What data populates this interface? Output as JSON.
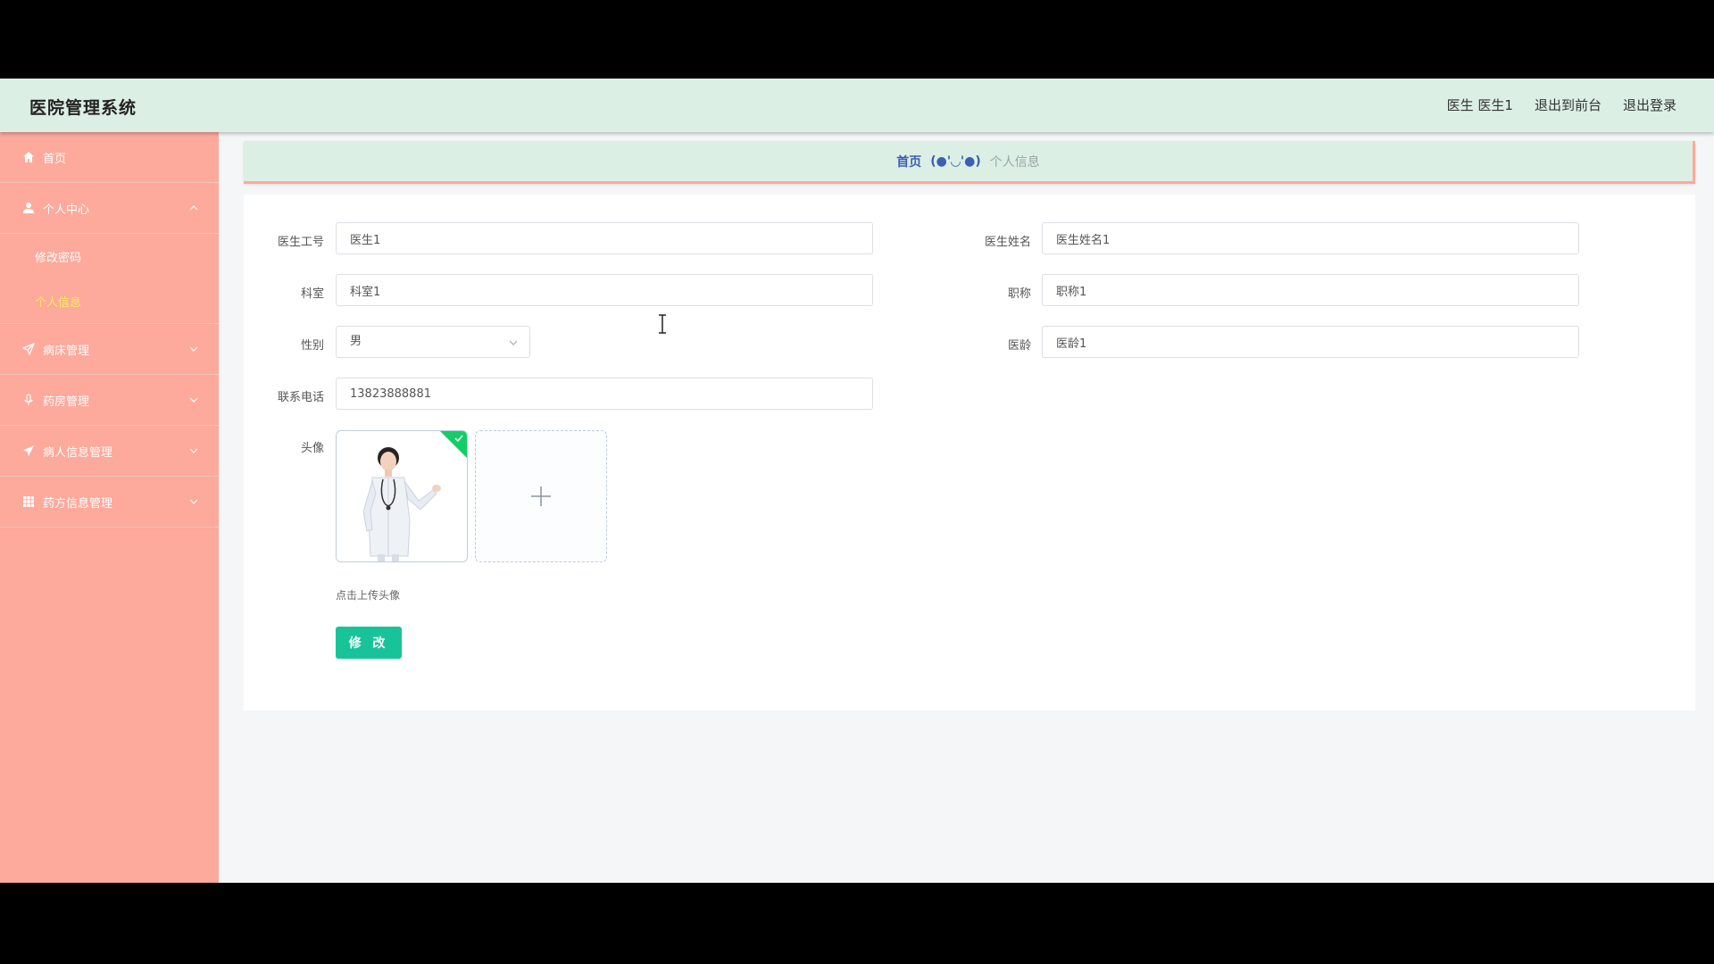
{
  "app": {
    "title": "医院管理系统"
  },
  "header": {
    "user_label": "医生 医生1",
    "to_front_label": "退出到前台",
    "logout_label": "退出登录"
  },
  "sidebar": {
    "items": [
      {
        "label": "首页",
        "icon": "home-icon"
      },
      {
        "label": "个人中心",
        "icon": "user-icon",
        "expanded": true,
        "children": [
          {
            "label": "修改密码",
            "active": false
          },
          {
            "label": "个人信息",
            "active": true
          }
        ]
      },
      {
        "label": "病床管理",
        "icon": "send-icon"
      },
      {
        "label": "药房管理",
        "icon": "microphone-icon"
      },
      {
        "label": "病人信息管理",
        "icon": "paper-plane-icon"
      },
      {
        "label": "药方信息管理",
        "icon": "grid-icon"
      }
    ]
  },
  "breadcrumb": {
    "home": "首页",
    "separator": "(●'◡'●)",
    "current": "个人信息"
  },
  "form": {
    "doctor_id": {
      "label": "医生工号",
      "value": "医生1"
    },
    "doctor_name": {
      "label": "医生姓名",
      "value": "医生姓名1"
    },
    "department": {
      "label": "科室",
      "value": "科室1"
    },
    "title": {
      "label": "职称",
      "value": "职称1"
    },
    "gender": {
      "label": "性别",
      "value": "男"
    },
    "years": {
      "label": "医龄",
      "value": "医龄1"
    },
    "phone": {
      "label": "联系电话",
      "value": "13823888881"
    },
    "avatar": {
      "label": "头像",
      "hint": "点击上传头像"
    },
    "submit_label": "修 改"
  },
  "colors": {
    "header_bg": "#dcefe5",
    "sidebar_bg": "#fda99b",
    "active_sub": "#ffef5b",
    "primary_button": "#19c39a",
    "success_check": "#13ce66"
  }
}
